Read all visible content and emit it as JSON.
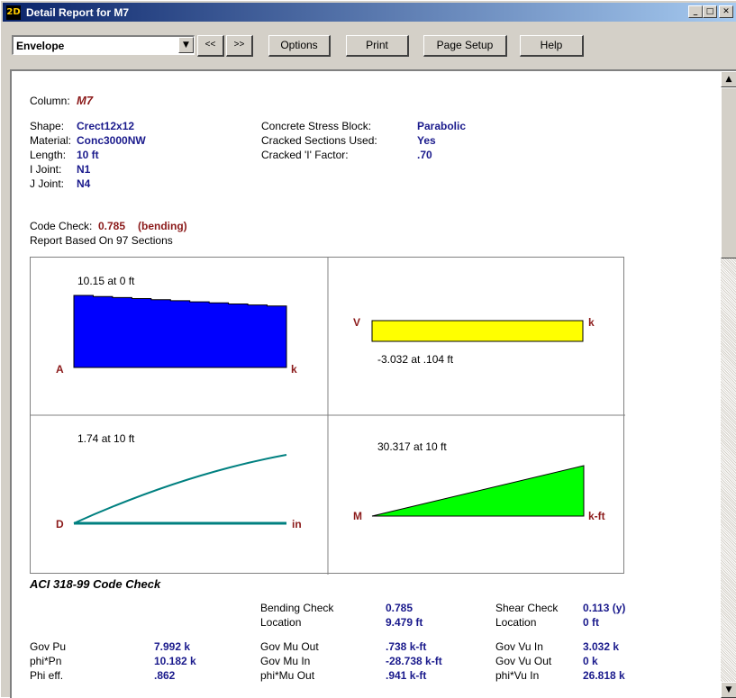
{
  "window": {
    "title": "Detail Report for M7",
    "icon_text": "2D"
  },
  "toolbar": {
    "combo_value": "Envelope",
    "prev_label": "<<",
    "next_label": ">>",
    "options_label": "Options",
    "print_label": "Print",
    "page_setup_label": "Page Setup",
    "help_label": "Help"
  },
  "report": {
    "column_label": "Column:",
    "column_name": "M7",
    "shape_label": "Shape:",
    "shape_value": "Crect12x12",
    "material_label": "Material:",
    "material_value": "Conc3000NW",
    "length_label": "Length:",
    "length_value": "10 ft",
    "ijoint_label": "I Joint:",
    "ijoint_value": "N1",
    "jjoint_label": "J Joint:",
    "jjoint_value": "N4",
    "stress_block_label": "Concrete Stress Block:",
    "stress_block_value": "Parabolic",
    "cracked_label": "Cracked Sections Used:",
    "cracked_value": "Yes",
    "cracked_factor_label": "Cracked 'I' Factor:",
    "cracked_factor_value": ".70",
    "code_check_label": "Code Check:",
    "code_check_value": "0.785",
    "code_check_note": "(bending)",
    "sections_text": "Report Based On 97 Sections"
  },
  "diagrams": {
    "axial": {
      "letter": "A",
      "unit": "k",
      "max_text": "10.15 at 0 ft",
      "color": "#0000ff",
      "values": [
        10.15,
        10.0,
        9.85,
        9.7,
        9.55,
        9.4,
        9.25,
        9.1,
        8.95,
        8.8,
        8.65
      ]
    },
    "shear": {
      "letter": "V",
      "unit": "k",
      "max_text": "-3.032 at .104 ft",
      "color": "#ffff00"
    },
    "deflection": {
      "letter": "D",
      "unit": "in",
      "max_text": "1.74 at 10 ft",
      "color": "#008080"
    },
    "moment": {
      "letter": "M",
      "unit": "k-ft",
      "max_text": "30.317 at 10 ft",
      "color": "#00ff00"
    }
  },
  "code_check": {
    "heading": "ACI 318-99 Code Check",
    "bending_check_label": "Bending Check",
    "bending_check_value": "0.785",
    "location1_label": "Location",
    "location1_value": "9.479 ft",
    "shear_check_label": "Shear Check",
    "shear_check_value": "0.113 (y)",
    "location2_label": "Location",
    "location2_value": "0 ft",
    "rows": [
      {
        "l1": "Gov Pu",
        "v1": "7.992 k",
        "l2": "Gov Mu Out",
        "v2": ".738 k-ft",
        "l3": "Gov Vu In",
        "v3": "3.032 k"
      },
      {
        "l1": "phi*Pn",
        "v1": "10.182 k",
        "l2": "Gov Mu In",
        "v2": "-28.738 k-ft",
        "l3": "Gov Vu Out",
        "v3": "0 k"
      },
      {
        "l1": "Phi eff.",
        "v1": ".862",
        "l2": "phi*Mu Out",
        "v2": ".941 k-ft",
        "l3": "phi*Vu In",
        "v3": "26.818 k"
      }
    ]
  }
}
